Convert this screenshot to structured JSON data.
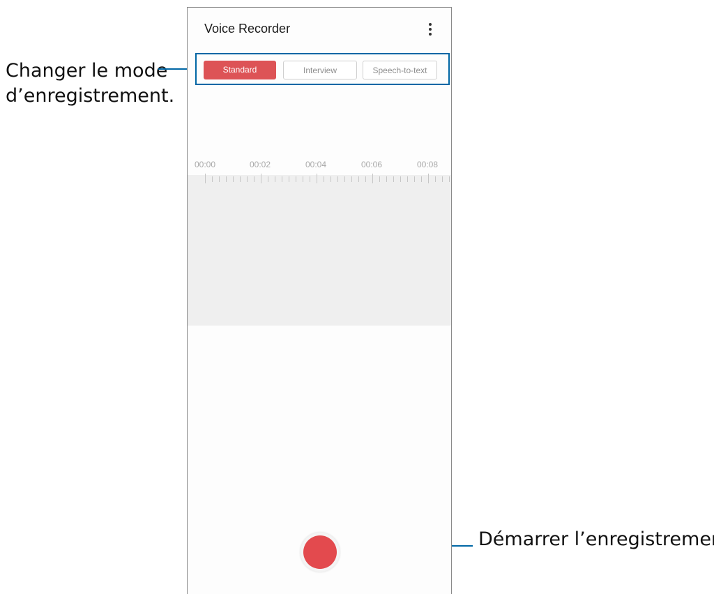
{
  "app": {
    "title": "Voice Recorder",
    "more_icon": "more-vertical-icon"
  },
  "modes": {
    "tabs": [
      {
        "label": "Standard",
        "selected": true
      },
      {
        "label": "Interview",
        "selected": false
      },
      {
        "label": "Speech-to-text",
        "selected": false
      }
    ]
  },
  "timeline": {
    "labels": [
      "00:00",
      "00:02",
      "00:04",
      "00:06",
      "00:08"
    ]
  },
  "callouts": {
    "mode_line1": "Changer le mode",
    "mode_line2": "d’enregistrement.",
    "record": "Démarrer l’enregistrement."
  },
  "colors": {
    "accent": "#dd5356",
    "record": "#e34a4e",
    "callout_line": "#0067a5"
  }
}
